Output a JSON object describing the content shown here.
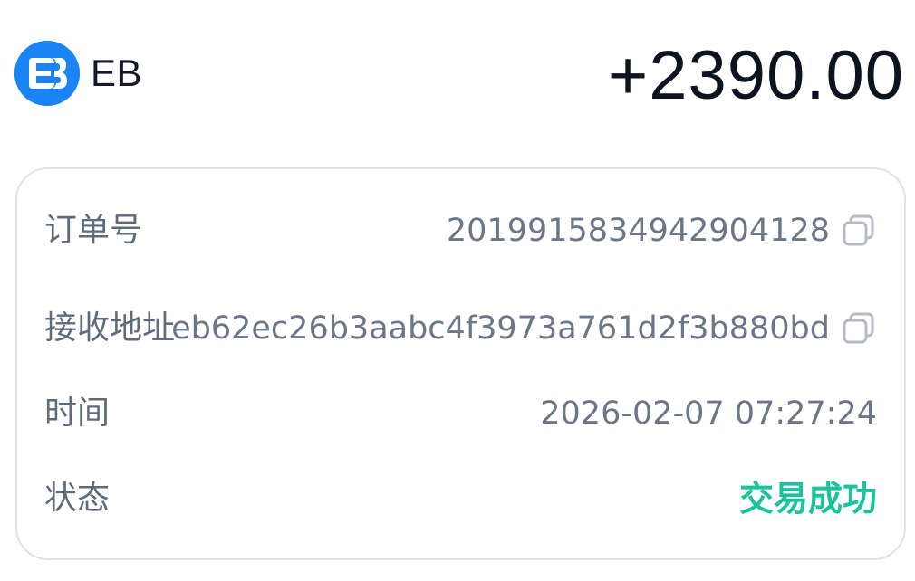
{
  "header": {
    "coin_symbol": "EB",
    "amount": "+2390.00",
    "coin_icon": "eb-coin-logo-icon",
    "brand_color": "#1b84f4"
  },
  "details": {
    "order_no": {
      "label": "订单号",
      "value": "2019915834942904128",
      "copy_icon": "copy-icon"
    },
    "address": {
      "label": "接收地址",
      "value": "eb62ec26b3aabc4f3973a761d2f3b880bd",
      "copy_icon": "copy-icon"
    },
    "time": {
      "label": "时间",
      "value": "2026-02-07 07:27:24"
    },
    "status": {
      "label": "状态",
      "value": "交易成功",
      "color": "#19c39b"
    }
  }
}
